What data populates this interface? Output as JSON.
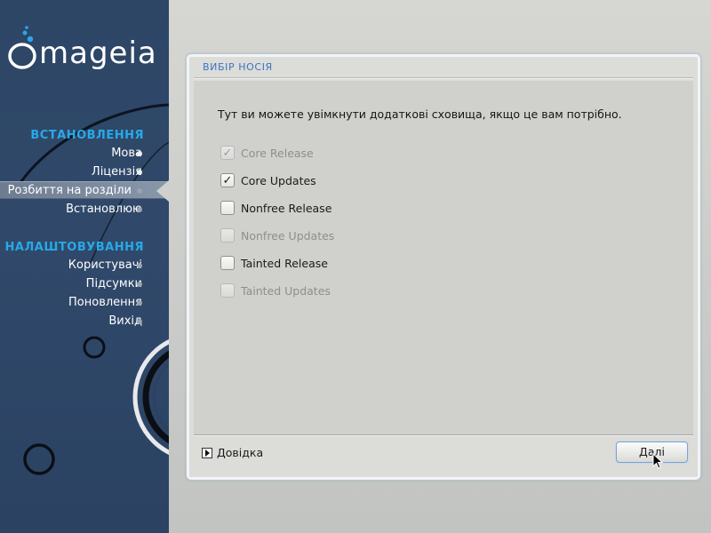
{
  "sidebar": {
    "logo_text": "mageia",
    "section_install": "ВСТАНОВЛЕННЯ",
    "install_steps": [
      {
        "label": "Мова",
        "state": "done"
      },
      {
        "label": "Ліцензія",
        "state": "done"
      },
      {
        "label": "Розбиття на розділи",
        "state": "active"
      },
      {
        "label": "Встановлюю",
        "state": "pending"
      }
    ],
    "section_config": "НАЛАШТОВУВАННЯ",
    "config_steps": [
      {
        "label": "Користувачі",
        "state": "pending"
      },
      {
        "label": "Підсумки",
        "state": "pending"
      },
      {
        "label": "Поновлення",
        "state": "pending"
      },
      {
        "label": "Вихід",
        "state": "pending"
      }
    ]
  },
  "panel": {
    "title": "ВИБІР НОСІЯ",
    "intro": "Тут ви можете увімкнути додаткові сховища, якщо це вам потрібно.",
    "options": [
      {
        "label": "Core Release",
        "checked": true,
        "enabled": false
      },
      {
        "label": "Core Updates",
        "checked": true,
        "enabled": true
      },
      {
        "label": "Nonfree Release",
        "checked": false,
        "enabled": true
      },
      {
        "label": "Nonfree Updates",
        "checked": false,
        "enabled": false
      },
      {
        "label": "Tainted Release",
        "checked": false,
        "enabled": true
      },
      {
        "label": "Tainted Updates",
        "checked": false,
        "enabled": false
      }
    ],
    "help_label": "Довідка",
    "next_label": "Далі"
  },
  "colors": {
    "sidebar_bg": "#2d4666",
    "section_title": "#27a9e8",
    "panel_title": "#3d74c0"
  }
}
